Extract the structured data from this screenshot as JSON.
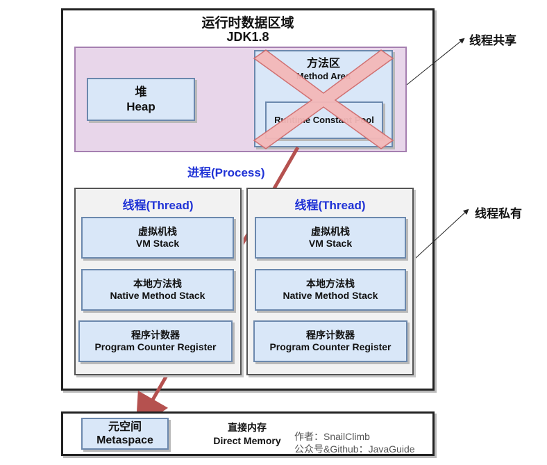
{
  "runtime": {
    "title": "运行时数据区域",
    "version": "JDK1.8"
  },
  "heap": {
    "cn": "堆",
    "en": "Heap"
  },
  "method_area": {
    "cn": "方法区",
    "en": "Method Area",
    "pool": "Runtime Constant Pool"
  },
  "process_label": "进程(Process)",
  "threads": [
    {
      "label": "线程(Thread)",
      "vm_stack": {
        "cn": "虚拟机栈",
        "en": "VM Stack"
      },
      "native_stack": {
        "cn": "本地方法栈",
        "en": "Native Method Stack"
      },
      "pc": {
        "cn": "程序计数器",
        "en": "Program Counter Register"
      }
    },
    {
      "label": "线程(Thread)",
      "vm_stack": {
        "cn": "虚拟机栈",
        "en": "VM Stack"
      },
      "native_stack": {
        "cn": "本地方法栈",
        "en": "Native Method Stack"
      },
      "pc": {
        "cn": "程序计数器",
        "en": "Program Counter Register"
      }
    }
  ],
  "annotations": {
    "shared": "线程共享",
    "private": "线程私有"
  },
  "metaspace": {
    "cn": "元空间",
    "en": "Metaspace"
  },
  "direct_memory": {
    "cn": "直接内存",
    "en": "Direct Memory"
  },
  "author": {
    "line1": "作者：SnailClimb",
    "line2": "公众号&Github：JavaGuide"
  },
  "colors": {
    "shared_fill": "#e8d6ea",
    "box_fill": "#d9e7f8",
    "arrow": "#b5514f",
    "cross_fill": "#f4b8b8",
    "process_text": "#1f32d6"
  }
}
